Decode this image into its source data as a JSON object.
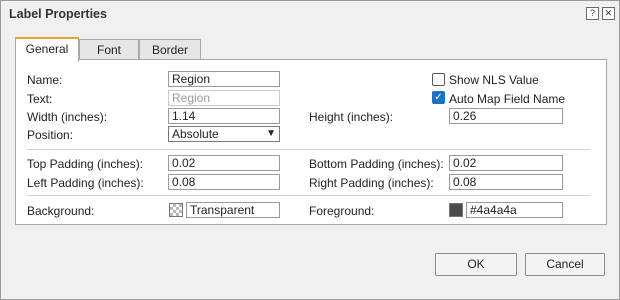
{
  "dialog": {
    "title": "Label Properties",
    "help_glyph": "?",
    "close_glyph": "✕"
  },
  "tabs": [
    {
      "label": "General",
      "active": true
    },
    {
      "label": "Font",
      "active": false
    },
    {
      "label": "Border",
      "active": false
    }
  ],
  "general": {
    "name_label": "Name:",
    "name_value": "Region",
    "text_label": "Text:",
    "text_value": "Region",
    "width_label": "Width (inches):",
    "width_value": "1.14",
    "height_label": "Height (inches):",
    "height_value": "0.26",
    "position_label": "Position:",
    "position_value": "Absolute",
    "show_nls_label": "Show NLS Value",
    "show_nls_checked": false,
    "auto_map_label": "Auto Map Field Name",
    "auto_map_checked": true,
    "top_padding_label": "Top Padding (inches):",
    "top_padding_value": "0.02",
    "bottom_padding_label": "Bottom Padding (inches):",
    "bottom_padding_value": "0.02",
    "left_padding_label": "Left Padding (inches):",
    "left_padding_value": "0.08",
    "right_padding_label": "Right Padding (inches):",
    "right_padding_value": "0.08",
    "background_label": "Background:",
    "background_value": "Transparent",
    "foreground_label": "Foreground:",
    "foreground_value": "#4a4a4a",
    "foreground_color": "#4a4a4a"
  },
  "buttons": {
    "ok": "OK",
    "cancel": "Cancel"
  },
  "colors": {
    "active_tab_accent": "#f0a030",
    "checkbox_checked": "#1a73c8"
  }
}
